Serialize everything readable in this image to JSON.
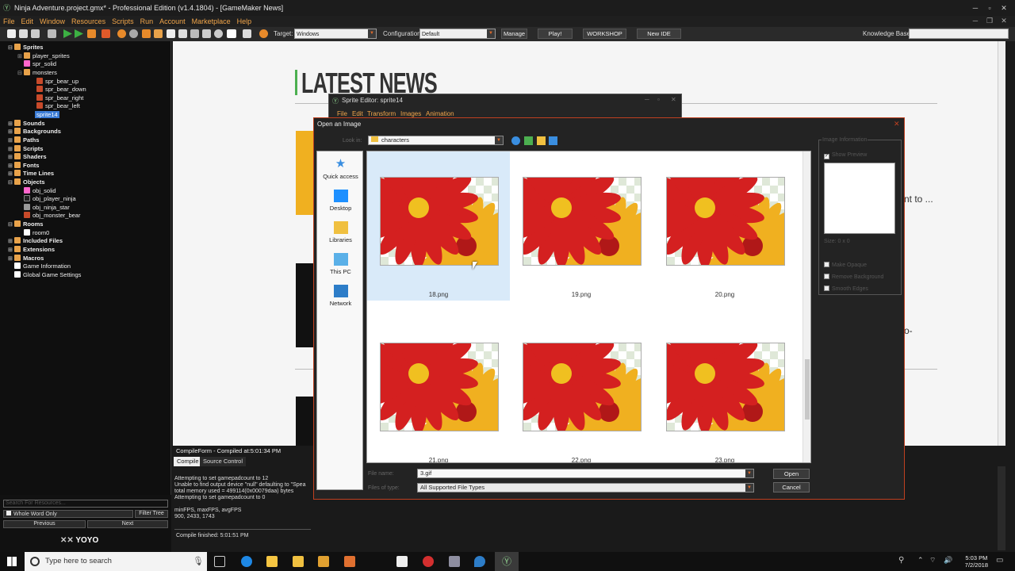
{
  "window": {
    "title": "Ninja Adventure.project.gmx*  -  Professional Edition (v1.4.1804)  -  [GameMaker News]",
    "menus": [
      "File",
      "Edit",
      "Window",
      "Resources",
      "Scripts",
      "Run",
      "Account",
      "Marketplace",
      "Help"
    ]
  },
  "toolbar": {
    "target_label": "Target:",
    "target_value": "Windows",
    "config_label": "Configuration:",
    "config_value": "Default",
    "manage": "Manage",
    "play": "Play!",
    "workshop": "WORKSHOP",
    "new_ide": "New IDE",
    "kb_label": "Knowledge Base:"
  },
  "tree": {
    "sprites": "Sprites",
    "player_sprites": "player_sprites",
    "spr_solid": "spr_solid",
    "monsters": "monsters",
    "spr_bear_up": "spr_bear_up",
    "spr_bear_down": "spr_bear_down",
    "spr_bear_right": "spr_bear_right",
    "spr_bear_left": "spr_bear_left",
    "sprite14": "sprite14",
    "sounds": "Sounds",
    "backgrounds": "Backgrounds",
    "paths": "Paths",
    "scripts": "Scripts",
    "shaders": "Shaders",
    "fonts": "Fonts",
    "timelines": "Time Lines",
    "objects": "Objects",
    "obj_solid": "obj_solid",
    "obj_player_ninja": "obj_player_ninja",
    "obj_ninja_star": "obj_ninja_star",
    "obj_monster_bear": "obj_monster_bear",
    "rooms": "Rooms",
    "room0": "room0",
    "included_files": "Included Files",
    "extensions": "Extensions",
    "macros": "Macros",
    "game_info": "Game Information",
    "global_settings": "Global Game Settings"
  },
  "tree_bottom": {
    "search_placeholder": "Search For Resources...",
    "whole_word": "Whole Word Only",
    "filter_tree": "Filter Tree",
    "previous": "Previous",
    "next": "Next",
    "logo_text": "YOYO GAMES"
  },
  "news": {
    "title": "LATEST NEWS",
    "snippet1": "nt to ...",
    "snippet2": "o-"
  },
  "compile": {
    "header": "CompileForm - Compiled at:5:01:34 PM",
    "tab_compile": "Compile",
    "tab_source": "Source Control",
    "log": "Attempting to set gamepadcount to 12\nUnable to find output device \"null\" defaulting to \"Spea\ntotal memory used = 499114(0x00079daa) bytes\nAttempting to set gamepadcount to 0\n\nminFPS, maxFPS, avgFPS\n900, 2433, 1743",
    "finished": "Compile finished: 5:01:51 PM"
  },
  "sprite_editor": {
    "title": "Sprite Editor: sprite14",
    "menus": [
      "File",
      "Edit",
      "Transform",
      "Images",
      "Animation"
    ]
  },
  "dialog": {
    "title": "Open an Image",
    "look_in_label": "Look in:",
    "look_in_value": "characters",
    "places": [
      "Quick access",
      "Desktop",
      "Libraries",
      "This PC",
      "Network"
    ],
    "files": [
      "18.png",
      "19.png",
      "20.png",
      "21.png",
      "22.png",
      "23.png"
    ],
    "filename_label": "File name:",
    "filename_value": "3.gif",
    "filetype_label": "Files of type:",
    "filetype_value": "All Supported File Types",
    "open": "Open",
    "cancel": "Cancel",
    "info_title": "Image Information",
    "show_preview": "Show Preview",
    "size": "Size: 0 x 0",
    "make_opaque": "Make Opaque",
    "remove_bg": "Remove Background",
    "smooth_edges": "Smooth Edges"
  },
  "taskbar": {
    "search_placeholder": "Type here to search",
    "time": "5:03 PM",
    "date": "7/2/2018"
  }
}
